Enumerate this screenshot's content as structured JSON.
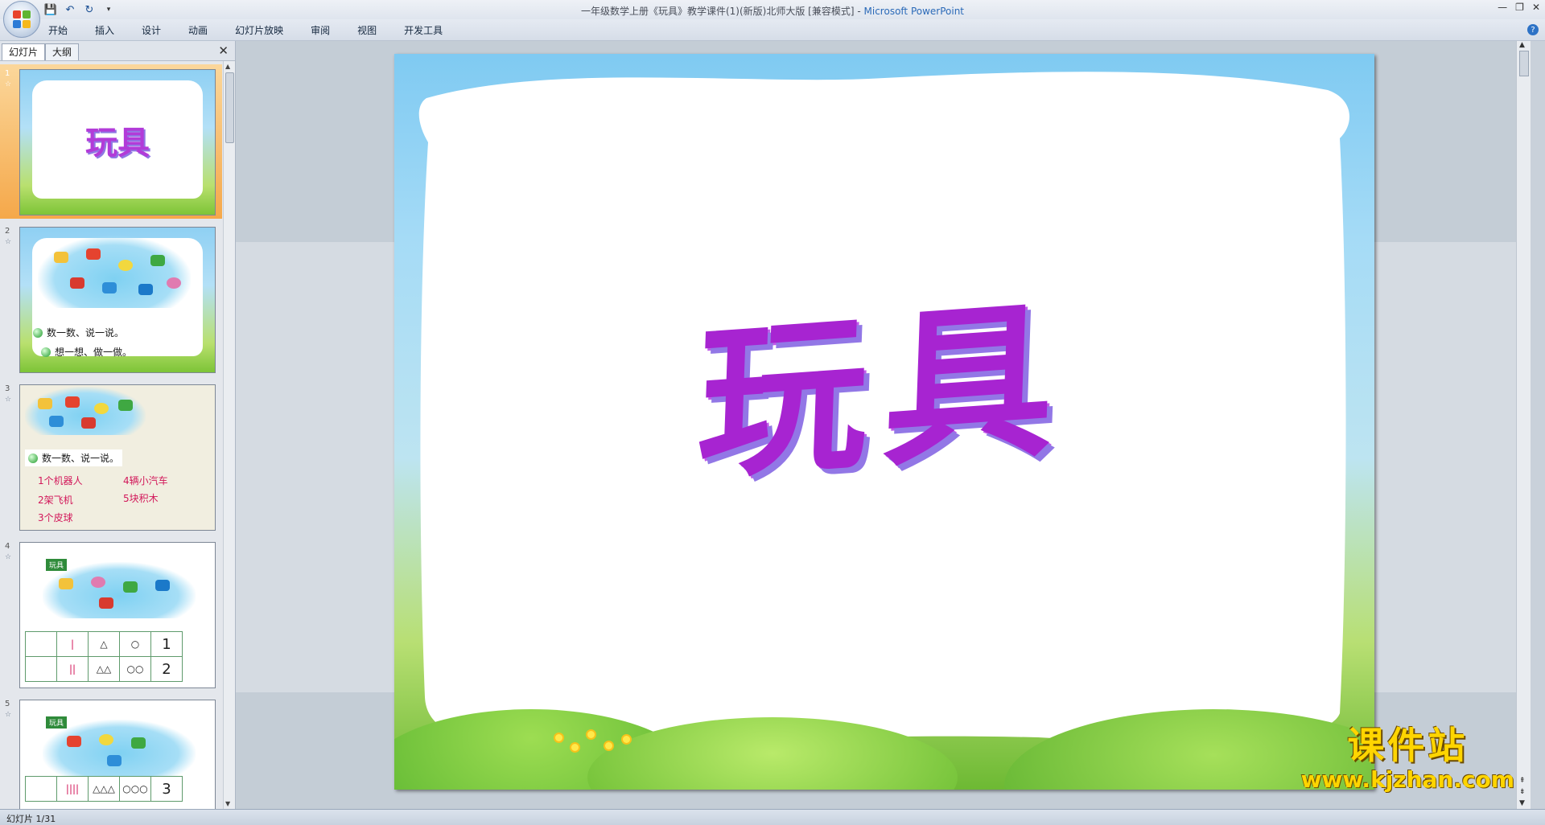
{
  "window": {
    "title": "一年级数学上册《玩具》教学课件(1)(新版)北师大版 [兼容模式]",
    "app_name": "Microsoft PowerPoint",
    "separator": "-",
    "minimize": "—",
    "restore": "❐",
    "close": "✕"
  },
  "quick_access": {
    "save_icon": "💾",
    "undo_icon": "↶",
    "redo_icon": "↻",
    "more_icon": "▾"
  },
  "ribbon": {
    "tabs": [
      "开始",
      "插入",
      "设计",
      "动画",
      "幻灯片放映",
      "审阅",
      "视图",
      "开发工具"
    ],
    "help": "?"
  },
  "left_panel": {
    "tabs": [
      "幻灯片",
      "大纲"
    ],
    "close": "✕",
    "thumbnails": [
      {
        "num": "1",
        "star": "☆",
        "title": "玩具"
      },
      {
        "num": "2",
        "star": "☆",
        "bullets": [
          "数一数、说一说。",
          "想一想、做一做。"
        ]
      },
      {
        "num": "3",
        "star": "☆",
        "heading": "数一数、说一说。",
        "items": [
          "1个机器人",
          "2架飞机",
          "3个皮球",
          "4辆小汽车",
          "5块积木"
        ]
      },
      {
        "num": "4",
        "star": "☆",
        "badge": "玩具",
        "row1": [
          "",
          "|",
          "△",
          "○",
          "1"
        ],
        "row2": [
          "",
          "||",
          "△△",
          "○○",
          "2"
        ]
      },
      {
        "num": "5",
        "star": "☆",
        "badge": "玩具",
        "row1": [
          "",
          "||||",
          "△△△",
          "○○○",
          "3"
        ]
      }
    ]
  },
  "slide": {
    "title": "玩具"
  },
  "status": {
    "text": "幻灯片 1/31"
  },
  "watermark": {
    "name": "课件站",
    "url": "www.kjzhan.com"
  },
  "colors": {
    "accent": "#2b6ab8",
    "title_purple": "#a724d1",
    "selected_thumb": "#f5a84a"
  }
}
